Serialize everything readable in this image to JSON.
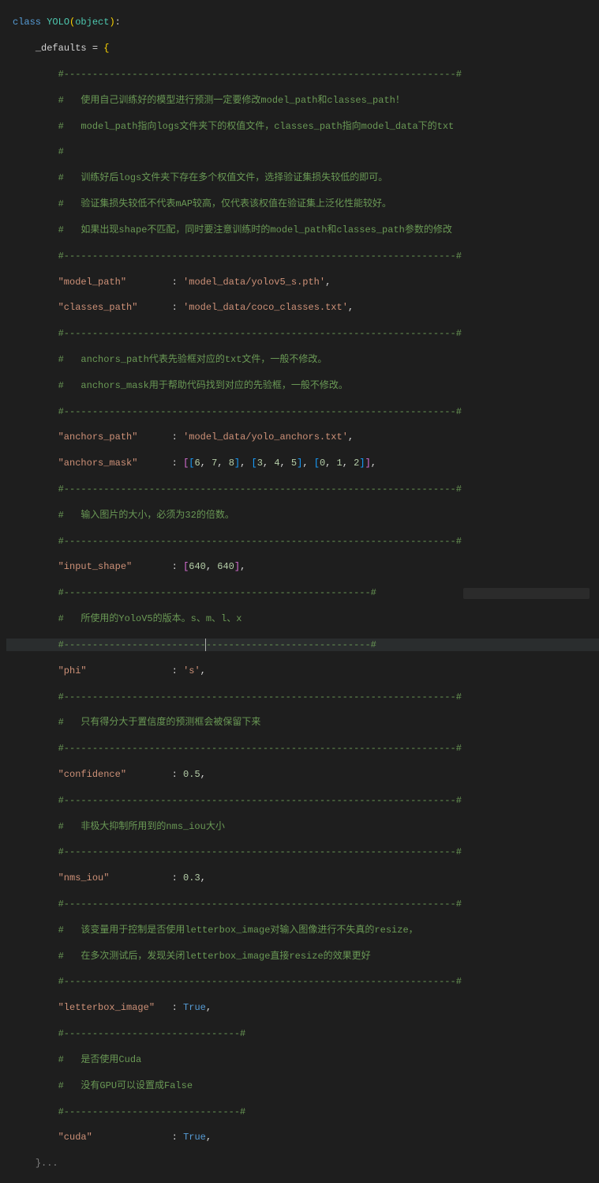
{
  "lines": {
    "l1": {
      "kw": "class",
      "cls": "YOLO",
      "builtin": "object"
    },
    "l2": {
      "ident": "_defaults",
      "op": "="
    },
    "sep": "#---------------------------------------------------------------------#",
    "sepS": "#---------------------------------------------------#",
    "sepM": "#------------------------------------------------------#",
    "c1": "#   使用自己训练好的模型进行预测一定要修改model_path和classes_path！",
    "c2": "#   model_path指向logs文件夹下的权值文件，classes_path指向model_data下的txt",
    "c3": "#",
    "c4": "#   训练好后logs文件夹下存在多个权值文件，选择验证集损失较低的即可。",
    "c5": "#   验证集损失较低不代表mAP较高，仅代表该权值在验证集上泛化性能较好。",
    "c6": "#   如果出现shape不匹配，同时要注意训练时的model_path和classes_path参数的修改",
    "kv_model_path_key": "\"model_path\"",
    "kv_model_path_val": "'model_data/yolov5_s.pth'",
    "kv_classes_path_key": "\"classes_path\"",
    "kv_classes_path_val": "'model_data/coco_classes.txt'",
    "c7": "#   anchors_path代表先验框对应的txt文件，一般不修改。",
    "c8": "#   anchors_mask用于帮助代码找到对应的先验框，一般不修改。",
    "kv_anchors_path_key": "\"anchors_path\"",
    "kv_anchors_path_val": "'model_data/yolo_anchors.txt'",
    "kv_anchors_mask_key": "\"anchors_mask\"",
    "am": [
      [
        6,
        7,
        8
      ],
      [
        3,
        4,
        5
      ],
      [
        0,
        1,
        2
      ]
    ],
    "c9": "#   输入图片的大小，必须为32的倍数。",
    "kv_input_shape_key": "\"input_shape\"",
    "input_shape": [
      640,
      640
    ],
    "c10": "#   所使用的YoloV5的版本。s、m、l、x",
    "kv_phi_key": "\"phi\"",
    "kv_phi_val": "'s'",
    "c11": "#   只有得分大于置信度的预测框会被保留下来",
    "kv_conf_key": "\"confidence\"",
    "kv_conf_val": "0.5",
    "c12": "#   非极大抑制所用到的nms_iou大小",
    "kv_nms_key": "\"nms_iou\"",
    "kv_nms_val": "0.3",
    "c13": "#   该变量用于控制是否使用letterbox_image对输入图像进行不失真的resize，",
    "c14": "#   在多次测试后，发现关闭letterbox_image直接resize的效果更好",
    "kv_lb_key": "\"letterbox_image\"",
    "kv_lb_val": "True",
    "c15": "#   是否使用Cuda",
    "c16": "#   没有GPU可以设置成False",
    "sepXS": "#-------------------------------#",
    "kv_cuda_key": "\"cuda\"",
    "kv_cuda_val": "True",
    "collapsed": "}..."
  }
}
